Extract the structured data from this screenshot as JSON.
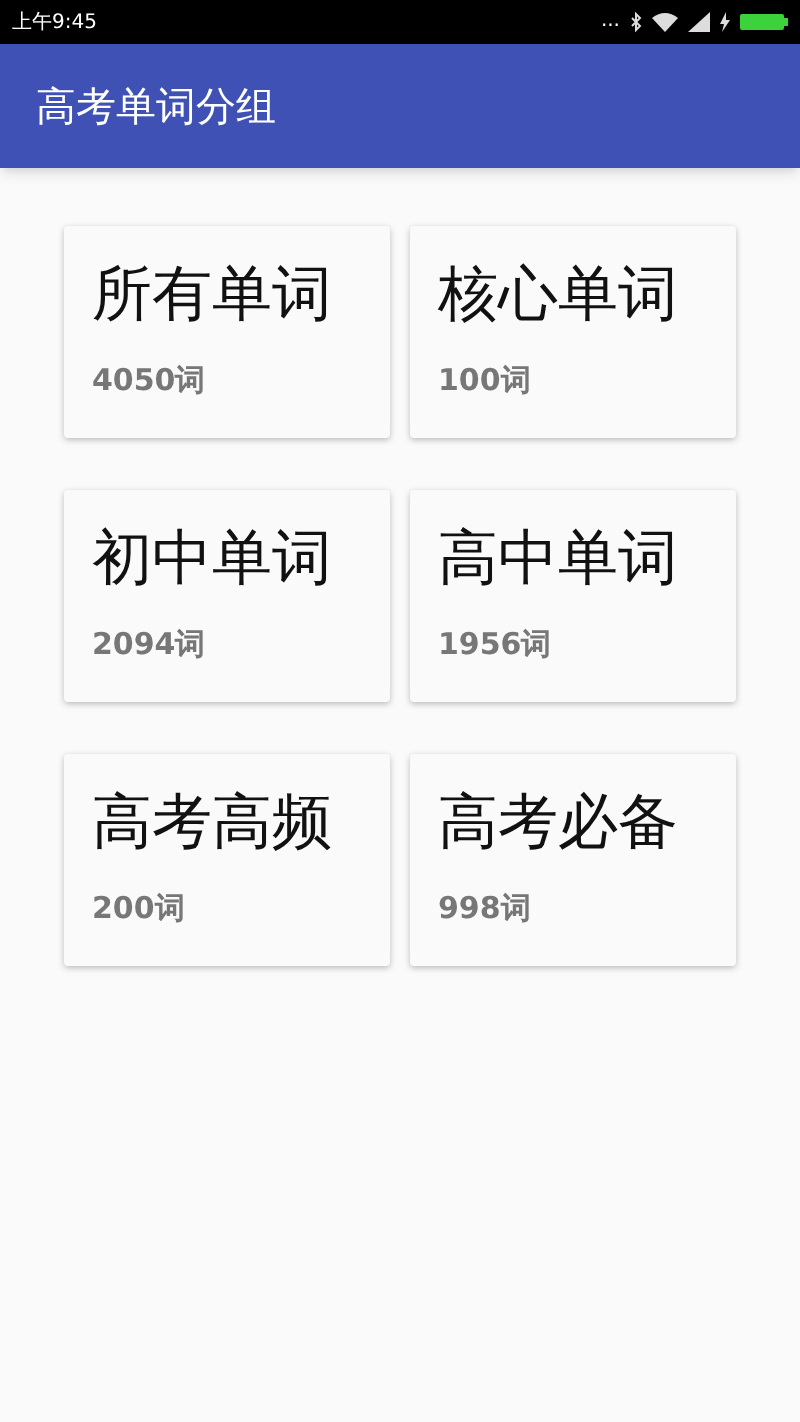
{
  "status_bar": {
    "time": "上午9:45",
    "dots": "..."
  },
  "app_bar": {
    "title": "高考单词分组"
  },
  "groups": [
    {
      "name": "所有单词",
      "count": "4050词"
    },
    {
      "name": "核心单词",
      "count": "100词"
    },
    {
      "name": "初中单词",
      "count": "2094词"
    },
    {
      "name": "高中单词",
      "count": "1956词"
    },
    {
      "name": "高考高频",
      "count": "200词"
    },
    {
      "name": "高考必备",
      "count": "998词"
    }
  ]
}
